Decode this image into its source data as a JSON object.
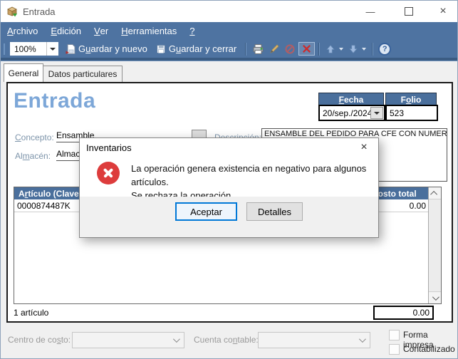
{
  "window": {
    "title": "Entrada"
  },
  "icons": {
    "minimize_glyph": "—",
    "close_glyph": "×",
    "help_glyph": "?",
    "dialog_close_glyph": "×"
  },
  "colors": {
    "bar_blue": "#4e73a1",
    "header_blue": "#4a6f9c",
    "heading_text": "#7da7d8",
    "error_red": "#dd3c3c",
    "focus_border": "#0078d7"
  },
  "menu": {
    "items": [
      {
        "key": "A",
        "rest": "rchivo"
      },
      {
        "key": "E",
        "rest": "dición"
      },
      {
        "key": "V",
        "rest": "er"
      },
      {
        "key": "H",
        "rest": "erramientas"
      },
      {
        "key": "?",
        "rest": ""
      }
    ]
  },
  "toolbar": {
    "zoom": "100%",
    "save_new": {
      "pre": "G",
      "key": "u",
      "post": "ardar y nuevo"
    },
    "save_close": {
      "pre": "G",
      "key": "u",
      "post": "ardar y cerrar"
    }
  },
  "tabs": {
    "general": "General",
    "datos": "Datos particulares"
  },
  "form": {
    "heading": "Entrada",
    "fecha": {
      "pre": "",
      "key": "F",
      "post": "echa"
    },
    "fecha_value": "20/sep./2024",
    "folio": {
      "pre": "F",
      "key": "o",
      "post": "lio"
    },
    "folio_value": "523",
    "concepto": {
      "pre": "",
      "key": "C",
      "post": "oncepto:"
    },
    "concepto_value": "Ensamble",
    "almacen": {
      "pre": "Al",
      "key": "m",
      "post": "acén:"
    },
    "almacen_value": "Almac",
    "descripcion_label": "Descripción:",
    "descripcion_value": "ENSAMBLE DEL PEDIDO PARA CFE CON NUMERO"
  },
  "table": {
    "col_articulo": {
      "pre": "A",
      "key": "r",
      "post": "tículo (Clave"
    },
    "col_costo": "Costo total",
    "rows": [
      {
        "articulo": "0000874487K",
        "costo": "0.00"
      }
    ],
    "count_label": "1 artículo",
    "total": "0.00"
  },
  "dialog": {
    "title": "Inventarios",
    "line1": "La operación genera existencia en negativo para algunos artículos.",
    "line2": "Se rechaza la operación.",
    "accept": "Aceptar",
    "details": "Detalles"
  },
  "footer": {
    "centro": {
      "pre": "Centro de co",
      "key": "s",
      "post": "to:"
    },
    "cuenta": {
      "pre": "Cuenta co",
      "key": "n",
      "post": "table:"
    },
    "forma": "Forma impresa",
    "contab": "Contabilizado"
  }
}
